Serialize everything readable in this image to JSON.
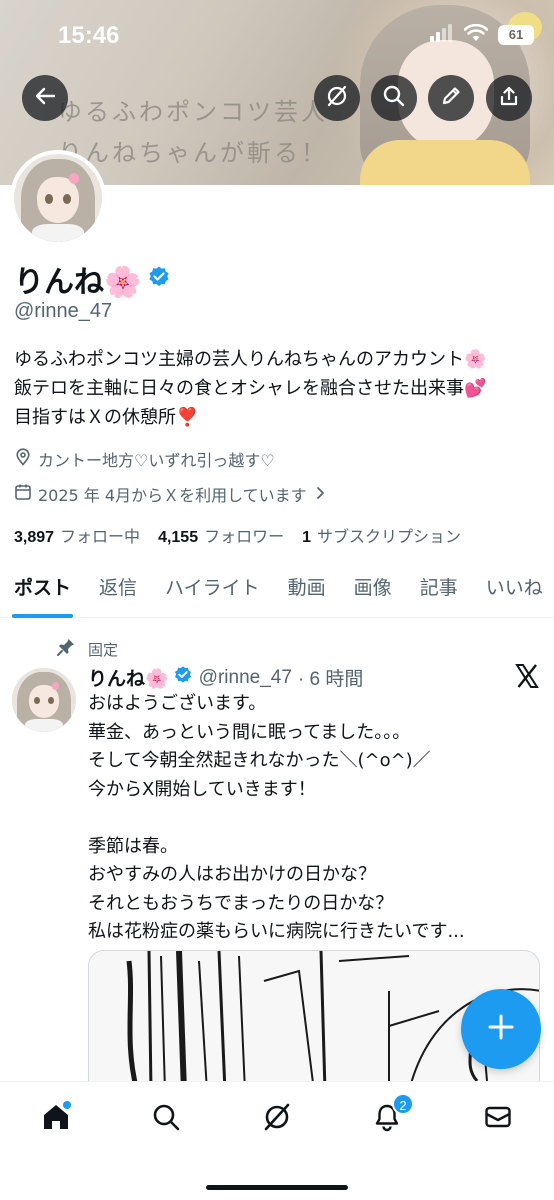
{
  "status_bar": {
    "time": "15:46",
    "battery": "61"
  },
  "banner": {
    "line1": "ゆるふわポンコツ芸人",
    "line2": "りんねちゃんが斬る！"
  },
  "profile": {
    "display_name": "りんね🌸",
    "handle": "@rinne_47",
    "bio": [
      "ゆるふわポンコツ主婦の芸人りんねちゃんのアカウント🌸",
      "飯テロを主軸に日々の食とオシャレを融合させた出来事💕",
      "目指すはＸの休憩所❣️"
    ],
    "location": "カントー地方♡いずれ引っ越す♡",
    "joined": "2025 年 4月からＸを利用しています",
    "following_count": "3,897",
    "following_label": "フォロー中",
    "followers_count": "4,155",
    "followers_label": "フォロワー",
    "subscriptions_count": "1",
    "subscriptions_label": "サブスクリプション"
  },
  "tabs": [
    "ポスト",
    "返信",
    "ハイライト",
    "動画",
    "画像",
    "記事",
    "いいね"
  ],
  "pinned_tweet": {
    "pinned_label": "固定",
    "name": "りんね🌸",
    "handle": "@rinne_47",
    "time": "· 6 時間",
    "text": "おはようございます。\n華金、あっという間に眠ってました。。。\nそして今朝全然起きれなかった＼(^o^)／\n今からX開始していきます！\n\n季節は春。\nおやすみの人はお出かけの日かな？\nそれともおうちでまったりの日かな？\n私は花粉症の薬もらいに病院に行きたいです..."
  },
  "bottom_nav": {
    "notifications_badge": "2"
  },
  "colors": {
    "accent": "#1d9bf0",
    "text": "#0f1419",
    "secondary": "#536471"
  },
  "icons": [
    "back-arrow-icon",
    "grok-icon",
    "search-icon",
    "edit-icon",
    "share-icon",
    "verified-badge-icon",
    "location-icon",
    "calendar-icon",
    "pin-icon",
    "x-logo-icon",
    "compose-icon",
    "home-icon",
    "search-icon",
    "grok-icon",
    "bell-icon",
    "mail-icon"
  ]
}
